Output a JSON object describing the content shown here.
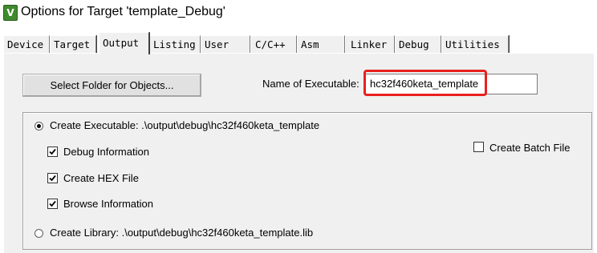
{
  "window": {
    "title": "Options for Target 'template_Debug'",
    "icon": "keil-uvision-icon"
  },
  "tabs": [
    {
      "label": "Device",
      "active": false
    },
    {
      "label": "Target",
      "active": false
    },
    {
      "label": "Output",
      "active": true
    },
    {
      "label": "Listing",
      "active": false
    },
    {
      "label": "User",
      "active": false
    },
    {
      "label": "C/C++",
      "active": false
    },
    {
      "label": "Asm",
      "active": false
    },
    {
      "label": "Linker",
      "active": false
    },
    {
      "label": "Debug",
      "active": false
    },
    {
      "label": "Utilities",
      "active": false
    }
  ],
  "output": {
    "select_folder_button": "Select Folder for Objects...",
    "name_label": "Name of Executable:",
    "name_value": "hc32f460keta_template",
    "create_executable": {
      "label": "Create Executable:  .\\output\\debug\\hc32f460keta_template",
      "selected": true
    },
    "debug_information": {
      "label": "Debug Information",
      "checked": true
    },
    "create_hex": {
      "label": "Create HEX File",
      "checked": true
    },
    "browse_information": {
      "label": "Browse Information",
      "checked": true
    },
    "create_batch": {
      "label": "Create Batch File",
      "checked": false
    },
    "create_library": {
      "label": "Create Library:  .\\output\\debug\\hc32f460keta_template.lib",
      "selected": false
    }
  },
  "colors": {
    "highlight": "#e8201c",
    "panel": "#f0f0f0"
  }
}
